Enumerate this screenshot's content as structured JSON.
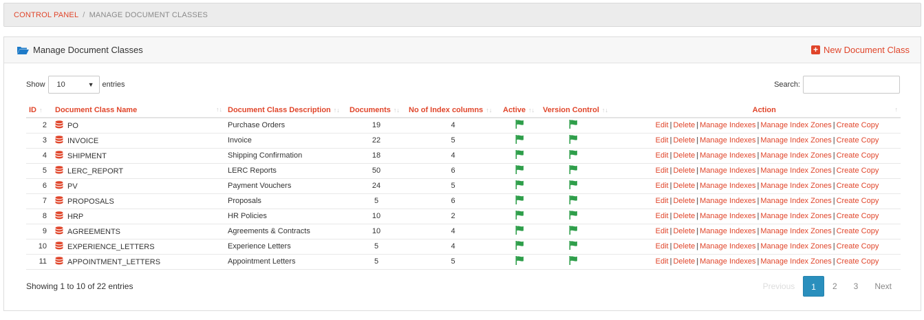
{
  "breadcrumb": {
    "root": "CONTROL PANEL",
    "separator": "/",
    "current": "MANAGE DOCUMENT CLASSES"
  },
  "panel": {
    "title": "Manage Document Classes",
    "new_button": "New Document Class"
  },
  "length": {
    "label_before": "Show",
    "selected": "10",
    "label_after": "entries"
  },
  "search": {
    "label": "Search:",
    "placeholder": ""
  },
  "columns": {
    "id": "ID",
    "name": "Document Class Name",
    "description": "Document Class Description",
    "documents": "Documents",
    "index_columns": "No of Index columns",
    "active": "Active",
    "version_control": "Version Control",
    "action": "Action"
  },
  "actions": {
    "edit": "Edit",
    "delete": "Delete",
    "manage_indexes": "Manage Indexes",
    "manage_index_zones": "Manage Index Zones",
    "create_copy": "Create Copy",
    "separator": "|"
  },
  "rows": [
    {
      "id": "2",
      "name": "PO",
      "description": "Purchase Orders",
      "documents": "19",
      "index_columns": "4"
    },
    {
      "id": "3",
      "name": "INVOICE",
      "description": "Invoice",
      "documents": "22",
      "index_columns": "5"
    },
    {
      "id": "4",
      "name": "SHIPMENT",
      "description": "Shipping Confirmation",
      "documents": "18",
      "index_columns": "4"
    },
    {
      "id": "5",
      "name": "LERC_REPORT",
      "description": "LERC Reports",
      "documents": "50",
      "index_columns": "6"
    },
    {
      "id": "6",
      "name": "PV",
      "description": "Payment Vouchers",
      "documents": "24",
      "index_columns": "5"
    },
    {
      "id": "7",
      "name": "PROPOSALS",
      "description": "Proposals",
      "documents": "5",
      "index_columns": "6"
    },
    {
      "id": "8",
      "name": "HRP",
      "description": "HR Policies",
      "documents": "10",
      "index_columns": "2"
    },
    {
      "id": "9",
      "name": "AGREEMENTS",
      "description": "Agreements & Contracts",
      "documents": "10",
      "index_columns": "4"
    },
    {
      "id": "10",
      "name": "EXPERIENCE_LETTERS",
      "description": "Experience Letters",
      "documents": "5",
      "index_columns": "4"
    },
    {
      "id": "11",
      "name": "APPOINTMENT_LETTERS",
      "description": "Appointment Letters",
      "documents": "5",
      "index_columns": "5"
    }
  ],
  "footer": {
    "info": "Showing 1 to 10 of 22 entries"
  },
  "pagination": {
    "previous": "Previous",
    "pages": [
      "1",
      "2",
      "3"
    ],
    "next": "Next",
    "current": "1"
  },
  "colors": {
    "accent": "#e0452a",
    "flag": "#2e9e4a",
    "page_active": "#2a8fbd",
    "folder": "#1e7bc8"
  },
  "icons": {
    "title": "folder-open-icon",
    "new": "plus-square-icon",
    "row": "database-icon",
    "status": "flag-icon"
  }
}
